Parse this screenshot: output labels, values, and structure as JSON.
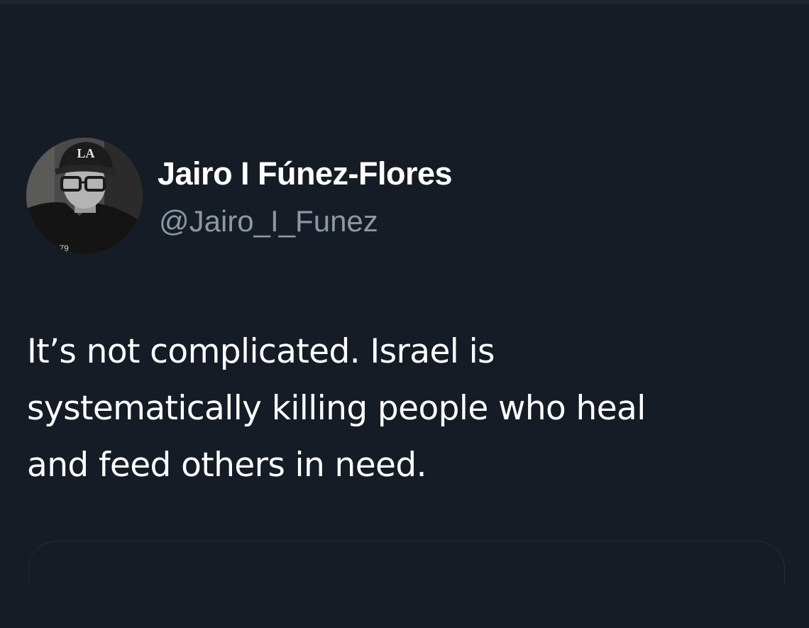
{
  "tweet": {
    "author": {
      "display_name": "Jairo I Fúnez-Flores",
      "handle": "@Jairo_I_Funez",
      "avatar": "avatar-photo",
      "cap_logo": "LA"
    },
    "text_lines": [
      "It’s not complicated. Israel is",
      "systematically killing people who heal",
      "and feed others in need."
    ]
  },
  "colors": {
    "background": "#161c26",
    "text": "#ffffff",
    "handle": "#8b98a5"
  }
}
